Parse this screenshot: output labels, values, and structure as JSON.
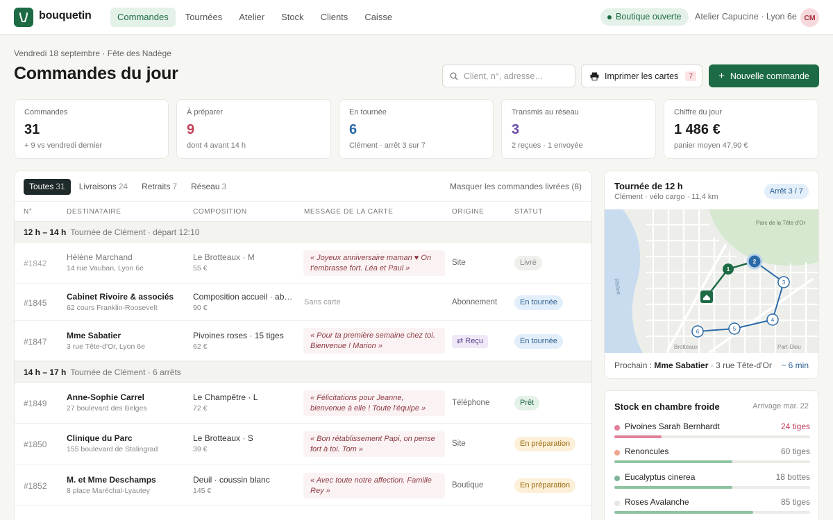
{
  "brand": "bouquetin",
  "nav": [
    "Commandes",
    "Tournées",
    "Atelier",
    "Stock",
    "Clients",
    "Caisse"
  ],
  "shop_status": "Boutique ouverte",
  "shop_name": "Atelier Capucine · Lyon 6e",
  "avatar": "CM",
  "header": {
    "date": "Vendredi 18 septembre · Fête des Nadège",
    "title": "Commandes du jour",
    "search_placeholder": "Client, n°, adresse…",
    "print_label": "Imprimer les cartes",
    "print_count": "7",
    "new_label": "Nouvelle commande"
  },
  "stats": [
    {
      "label": "Commandes",
      "value": "31",
      "sub": "+ 9 vs vendredi dernier",
      "color": "#1b1b1b"
    },
    {
      "label": "À préparer",
      "value": "9",
      "sub": "dont 4 avant 14 h",
      "color": "#c2405a"
    },
    {
      "label": "En tournée",
      "value": "6",
      "sub": "Clément · arrêt 3 sur 7",
      "color": "#2b6aa8"
    },
    {
      "label": "Transmis au réseau",
      "value": "3",
      "sub": "2 reçues · 1 envoyée",
      "color": "#6a4aa6"
    },
    {
      "label": "Chiffre du jour",
      "value": "1 486 €",
      "sub": "panier moyen 47,90 €",
      "color": "#1b1b1b"
    }
  ],
  "filters": [
    {
      "label": "Toutes",
      "count": "31"
    },
    {
      "label": "Livraisons",
      "count": "24"
    },
    {
      "label": "Retraits",
      "count": "7"
    },
    {
      "label": "Réseau",
      "count": "3"
    }
  ],
  "hide_delivered": "Masquer les commandes livrées (8)",
  "columns": [
    "N°",
    "DESTINATAIRE",
    "COMPOSITION",
    "MESSAGE DE LA CARTE",
    "ORIGINE",
    "STATUT"
  ],
  "groups": [
    {
      "time": "12 h – 14 h",
      "label": "Tournée de Clément · départ 12:10"
    },
    {
      "time": "14 h – 17 h",
      "label": "Tournée de Clément · 6 arrêts"
    }
  ],
  "rows": [
    {
      "num": "#1842",
      "name": "Hélène Marchand",
      "addr": "14 rue Vauban, Lyon 6e",
      "comp": "Le Brotteaux · M",
      "price": "55 €",
      "message": "« Joyeux anniversaire maman ♥ On t'embrasse fort. Léa et Paul »",
      "origin": "Site",
      "status": "Livré"
    },
    {
      "num": "#1845",
      "name": "Cabinet Rivoire & associés",
      "addr": "62 cours Franklin-Roosevelt",
      "comp": "Composition accueil · abonnement",
      "price": "90 €",
      "message": "Sans carte",
      "origin": "Abonnement",
      "status": "En tournée"
    },
    {
      "num": "#1847",
      "name": "Mme Sabatier",
      "addr": "3 rue Tête-d'Or, Lyon 6e",
      "comp": "Pivoines roses · 15 tiges",
      "price": "62 €",
      "message": "« Pour ta première semaine chez toi. Bienvenue ! Marion »",
      "origin": "⇄ Reçu",
      "status": "En tournée"
    },
    {
      "num": "#1849",
      "name": "Anne-Sophie Carrel",
      "addr": "27 boulevard des Belges",
      "comp": "Le Champêtre · L",
      "price": "72 €",
      "message": "« Félicitations pour Jeanne, bienvenue à elle ! Toute l'équipe »",
      "origin": "Téléphone",
      "status": "Prêt"
    },
    {
      "num": "#1850",
      "name": "Clinique du Parc",
      "addr": "155 boulevard de Stalingrad",
      "comp": "Le Brotteaux · S",
      "price": "39 €",
      "message": "« Bon rétablissement Papi, on pense fort à toi. Tom »",
      "origin": "Site",
      "status": "En préparation"
    },
    {
      "num": "#1852",
      "name": "M. et Mme Deschamps",
      "addr": "8 place Maréchal-Lyautey",
      "comp": "Deuil · coussin blanc",
      "price": "145 €",
      "message": "« Avec toute notre affection. Famille Rey »",
      "origin": "Boutique",
      "status": "En préparation"
    }
  ],
  "route": {
    "title": "Tournée de 12 h",
    "sub": "Clément · vélo cargo · 11,4 km",
    "badge": "Arrêt 3 / 7",
    "map_labels": {
      "park": "Parc de la Tête d'Or",
      "river": "Rhône",
      "left": "Brotteaux",
      "right": "Part-Dieu"
    },
    "stops": [
      "1",
      "2",
      "3",
      "4",
      "5",
      "6"
    ],
    "next_label": "Prochain :",
    "next_name": "Mme Sabatier",
    "next_addr": "· 3 rue Tête-d'Or",
    "eta": "~ 6 min"
  },
  "stock": {
    "title": "Stock en chambre froide",
    "arrival": "Arrivage mar. 22",
    "items": [
      {
        "name": "Pivoines Sarah Bernhardt",
        "qty": "24 tiges",
        "level": 0.24,
        "color": "#e0809a",
        "fill": "#e0809a",
        "low": true
      },
      {
        "name": "Renoncules",
        "qty": "60 tiges",
        "level": 0.6,
        "color": "#f0a58a",
        "fill": "#8fc3a2",
        "low": false
      },
      {
        "name": "Eucalyptus cinerea",
        "qty": "18 bottes",
        "level": 0.6,
        "color": "#7eb39a",
        "fill": "#8fc3a2",
        "low": false
      },
      {
        "name": "Roses Avalanche",
        "qty": "85 tiges",
        "level": 0.71,
        "color": "#e6e6e2",
        "fill": "#8fc3a2",
        "low": false
      }
    ]
  }
}
